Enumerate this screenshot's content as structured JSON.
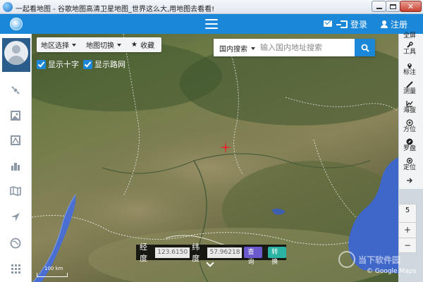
{
  "window": {
    "title": "一起看地图 - 谷歌地图高清卫星地图_世界这么大,用地图去看看!",
    "minimize_icon": "minimize-icon",
    "maximize_icon": "maximize-icon",
    "close_icon": "close-icon"
  },
  "header": {
    "login_label": "登录",
    "register_label": "注册",
    "accent_color": "#1a87d8"
  },
  "sidebar": {
    "items": [
      {
        "name": "satellite-icon"
      },
      {
        "name": "photo-icon"
      },
      {
        "name": "map-frame-icon"
      },
      {
        "name": "buildings-icon"
      },
      {
        "name": "folded-map-icon"
      },
      {
        "name": "navigation-icon"
      },
      {
        "name": "globe-icon"
      },
      {
        "name": "apps-grid-icon"
      }
    ]
  },
  "map_toolbar": {
    "region_select": "地区选择",
    "map_switch": "地图切换",
    "favorites": "收藏"
  },
  "checkboxes": {
    "show_crosshair": "显示十字",
    "show_roads": "显示路网"
  },
  "search": {
    "scope": "国内搜索",
    "placeholder": "输入国内地址搜索"
  },
  "right_tools": [
    {
      "label": "全屏",
      "icon": "fullscreen-icon"
    },
    {
      "label": "工具",
      "icon": "wrench-icon"
    },
    {
      "label": "标注",
      "icon": "pin-icon"
    },
    {
      "label": "测量",
      "icon": "ruler-icon"
    },
    {
      "label": "海拔",
      "icon": "elevation-icon"
    },
    {
      "label": "方位",
      "icon": "target-icon"
    },
    {
      "label": "罗盘",
      "icon": "compass-icon"
    },
    {
      "label": "定位",
      "icon": "locate-icon"
    }
  ],
  "zoom": {
    "level": "5",
    "zoom_in": "+",
    "zoom_out": "−"
  },
  "coords": {
    "lng_label": "经度",
    "lng_value": "123.6150",
    "lat_label": "纬度",
    "lat_value": "57.96218",
    "query_label": "查询",
    "convert_label": "转换"
  },
  "attribution": "© Google Maps",
  "watermark": "当下软件园",
  "scale_label": "100 km"
}
